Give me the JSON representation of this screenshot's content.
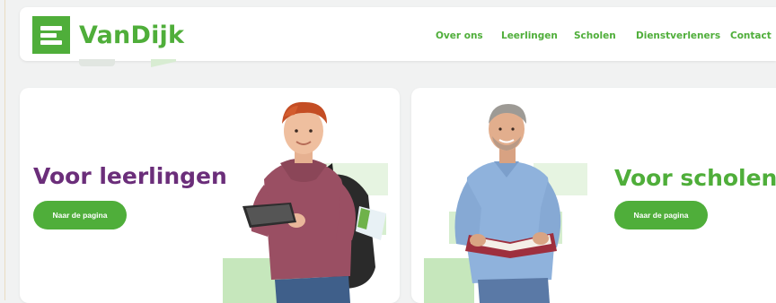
{
  "header": {
    "brand": "VanDijk",
    "nav": [
      "Over ons",
      "Leerlingen",
      "Scholen",
      "Dienstverleners",
      "Contact"
    ]
  },
  "cards": [
    {
      "title": "Voor leerlingen",
      "button": "Naar de pagina"
    },
    {
      "title": "Voor scholen",
      "button": "Naar de pagina"
    }
  ],
  "colors": {
    "brand_green": "#4fae3a",
    "purple": "#6b2e7a",
    "light_green": "#e3f3dd",
    "mid_green": "#bfe3b4"
  }
}
